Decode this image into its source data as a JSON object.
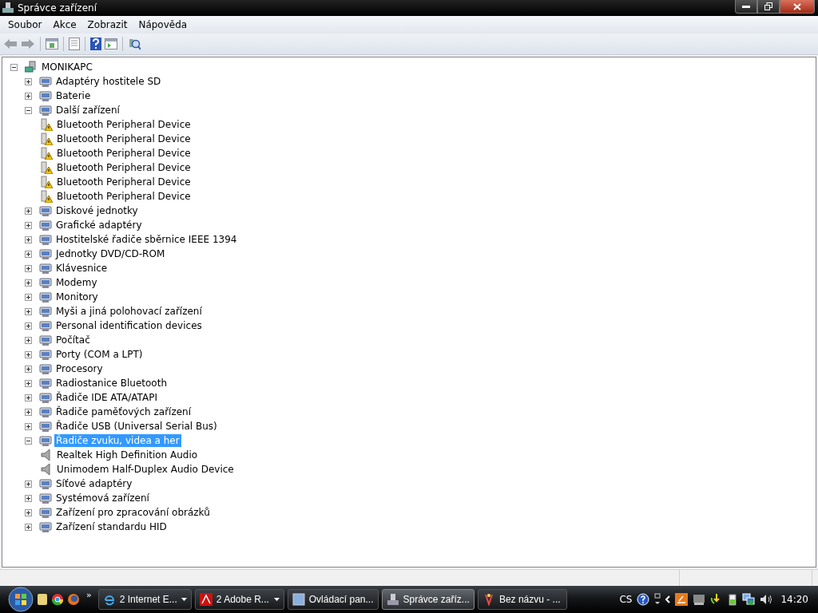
{
  "window": {
    "title": "Správce zařízení"
  },
  "menu": [
    "Soubor",
    "Akce",
    "Zobrazit",
    "Nápověda"
  ],
  "tree": {
    "label": "MONIKAPC",
    "expanded": true,
    "children": [
      {
        "label": "Adaptéry hostitele SD",
        "expanded": false,
        "selected": false
      },
      {
        "label": "Baterie",
        "expanded": false,
        "selected": false
      },
      {
        "label": "Další zařízení",
        "expanded": true,
        "selected": false,
        "children": [
          {
            "label": "Bluetooth Peripheral Device",
            "warning": true,
            "selected": false
          },
          {
            "label": "Bluetooth Peripheral Device",
            "warning": true,
            "selected": false
          },
          {
            "label": "Bluetooth Peripheral Device",
            "warning": true,
            "selected": false
          },
          {
            "label": "Bluetooth Peripheral Device",
            "warning": true,
            "selected": false
          },
          {
            "label": "Bluetooth Peripheral Device",
            "warning": true,
            "selected": false
          },
          {
            "label": "Bluetooth Peripheral Device",
            "warning": true,
            "selected": false
          }
        ]
      },
      {
        "label": "Diskové jednotky",
        "expanded": false,
        "selected": false
      },
      {
        "label": "Grafické adaptéry",
        "expanded": false,
        "selected": false
      },
      {
        "label": "Hostitelské řadiče sběrnice IEEE 1394",
        "expanded": false,
        "selected": false
      },
      {
        "label": "Jednotky DVD/CD-ROM",
        "expanded": false,
        "selected": false
      },
      {
        "label": "Klávesnice",
        "expanded": false,
        "selected": false
      },
      {
        "label": "Modemy",
        "expanded": false,
        "selected": false
      },
      {
        "label": "Monitory",
        "expanded": false,
        "selected": false
      },
      {
        "label": "Myši a jiná polohovací zařízení",
        "expanded": false,
        "selected": false
      },
      {
        "label": "Personal identification devices",
        "expanded": false,
        "selected": false
      },
      {
        "label": "Počítač",
        "expanded": false,
        "selected": false
      },
      {
        "label": "Porty (COM a LPT)",
        "expanded": false,
        "selected": false
      },
      {
        "label": "Procesory",
        "expanded": false,
        "selected": false
      },
      {
        "label": "Radiostanice Bluetooth",
        "expanded": false,
        "selected": false
      },
      {
        "label": "Řadiče IDE ATA/ATAPI",
        "expanded": false,
        "selected": false
      },
      {
        "label": "Řadiče paměťových zařízení",
        "expanded": false,
        "selected": false
      },
      {
        "label": "Řadiče USB (Universal Serial Bus)",
        "expanded": false,
        "selected": false
      },
      {
        "label": "Řadiče zvuku, videa a her",
        "expanded": true,
        "selected": true,
        "children": [
          {
            "label": "Realtek High Definition Audio",
            "warning": false,
            "selected": false
          },
          {
            "label": "Unimodem Half-Duplex Audio Device",
            "warning": false,
            "selected": false
          }
        ]
      },
      {
        "label": "Síťové adaptéry",
        "expanded": false,
        "selected": false
      },
      {
        "label": "Systémová zařízení",
        "expanded": false,
        "selected": false
      },
      {
        "label": "Zařízení pro zpracování obrázků",
        "expanded": false,
        "selected": false
      },
      {
        "label": "Zařízení standardu HID",
        "expanded": false,
        "selected": false
      }
    ]
  },
  "taskbar": {
    "overflow": "»",
    "buttons": [
      {
        "label": "2 Internet E...",
        "grouped": true,
        "selected": false
      },
      {
        "label": "2 Adobe R...",
        "grouped": true,
        "selected": false
      },
      {
        "label": "Ovládací pan...",
        "grouped": false,
        "selected": false
      },
      {
        "label": "Správce zaříz...",
        "grouped": false,
        "selected": true
      },
      {
        "label": "Bez názvu - ...",
        "grouped": false,
        "selected": false
      }
    ],
    "language": "CS",
    "clock": "14:20"
  }
}
